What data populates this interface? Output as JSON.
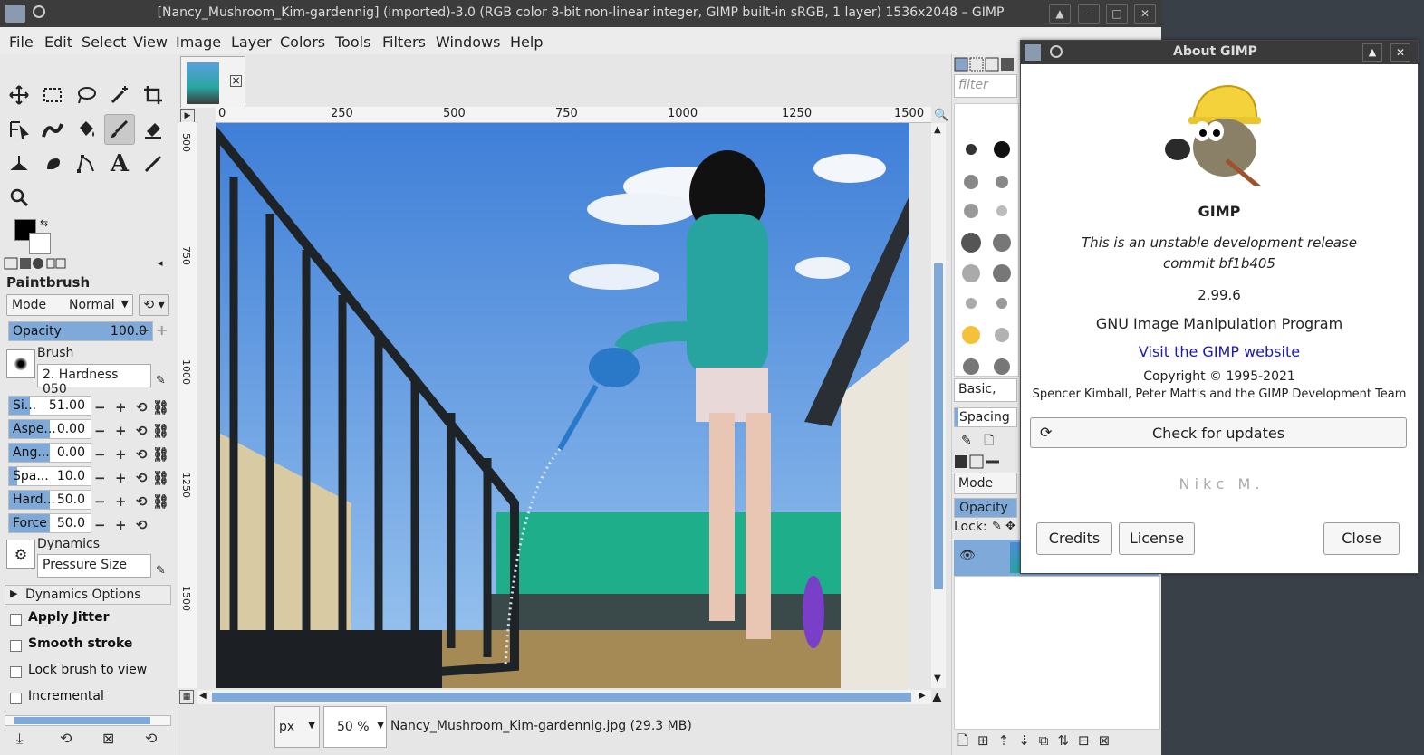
{
  "window": {
    "title": "[Nancy_Mushroom_Kim-gardennig] (imported)-3.0 (RGB color 8-bit non-linear integer, GIMP built-in sRGB, 1 layer) 1536x2048 – GIMP"
  },
  "menu": [
    "File",
    "Edit",
    "Select",
    "View",
    "Image",
    "Layer",
    "Colors",
    "Tools",
    "Filters",
    "Windows",
    "Help"
  ],
  "tool_options": {
    "tool_name": "Paintbrush",
    "mode_label": "Mode",
    "mode_value": "Normal",
    "opacity": {
      "label": "Opacity",
      "value": "100.0",
      "fraction": 1.0
    },
    "brush_label": "Brush",
    "brush_value": "2. Hardness 050",
    "sliders": [
      {
        "label": "Si...",
        "value": "51.00",
        "fraction": 0.25
      },
      {
        "label": "Aspe...",
        "value": "0.00",
        "fraction": 0.5
      },
      {
        "label": "Ang...",
        "value": "0.00",
        "fraction": 0.5
      },
      {
        "label": "Spa...",
        "value": "10.0",
        "fraction": 0.1
      },
      {
        "label": "Hard...",
        "value": "50.0",
        "fraction": 0.5
      },
      {
        "label": "Force",
        "value": "50.0",
        "fraction": 0.5
      }
    ],
    "dynamics_label": "Dynamics",
    "dynamics_value": "Pressure Size",
    "dynamics_options": "Dynamics Options",
    "checkboxes": [
      "Apply Jitter",
      "Smooth stroke",
      "Lock brush to view",
      "Incremental"
    ]
  },
  "ruler": {
    "top_ticks": [
      "0",
      "250",
      "500",
      "750",
      "1000",
      "1250",
      "1500"
    ],
    "left_ticks": [
      "500",
      "750",
      "1000",
      "1250",
      "1500"
    ]
  },
  "statusbar": {
    "unit": "px",
    "zoom": "50 %",
    "file_info": "Nancy_Mushroom_Kim-gardennig.jpg (29.3 MB)"
  },
  "dock": {
    "filter_placeholder": "filter",
    "brush_set": "Basic,",
    "spacing_label": "Spacing",
    "mode_label": "Mode",
    "opacity_label": "Opacity",
    "lock_label": "Lock:"
  },
  "about": {
    "title": "About GIMP",
    "app_name": "GIMP",
    "unstable_line1": "This is an unstable development release",
    "unstable_line2": "commit bf1b405",
    "version": "2.99.6",
    "full_name": "GNU Image Manipulation Program",
    "website_link": "Visit the GIMP website",
    "copyright": "Copyright © 1995-2021",
    "authors": "Spencer Kimball, Peter Mattis and the GIMP Development Team",
    "check_updates": "Check for updates",
    "author_scroll": "N i k c   M .",
    "credits": "Credits",
    "license": "License",
    "close": "Close"
  }
}
